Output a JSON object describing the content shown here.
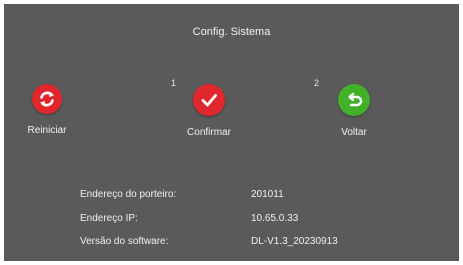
{
  "window": {
    "title": "Config. Sistema"
  },
  "actions": [
    {
      "label": "Reiniciar",
      "number": "",
      "color": "#e0272d",
      "icon": "refresh-icon"
    },
    {
      "label": "Confirmar",
      "number": "1",
      "color": "#e0272d",
      "icon": "checkmark-icon"
    },
    {
      "label": "Voltar",
      "number": "2",
      "color": "#43b02a",
      "icon": "back-arrow-icon"
    }
  ],
  "info": [
    {
      "label": "Endereço do porteiro:",
      "value": "201011"
    },
    {
      "label": "Endereço IP:",
      "value": "10.65.0.33"
    },
    {
      "label": "Versão do software:",
      "value": "DL-V1.3_20230913"
    }
  ]
}
